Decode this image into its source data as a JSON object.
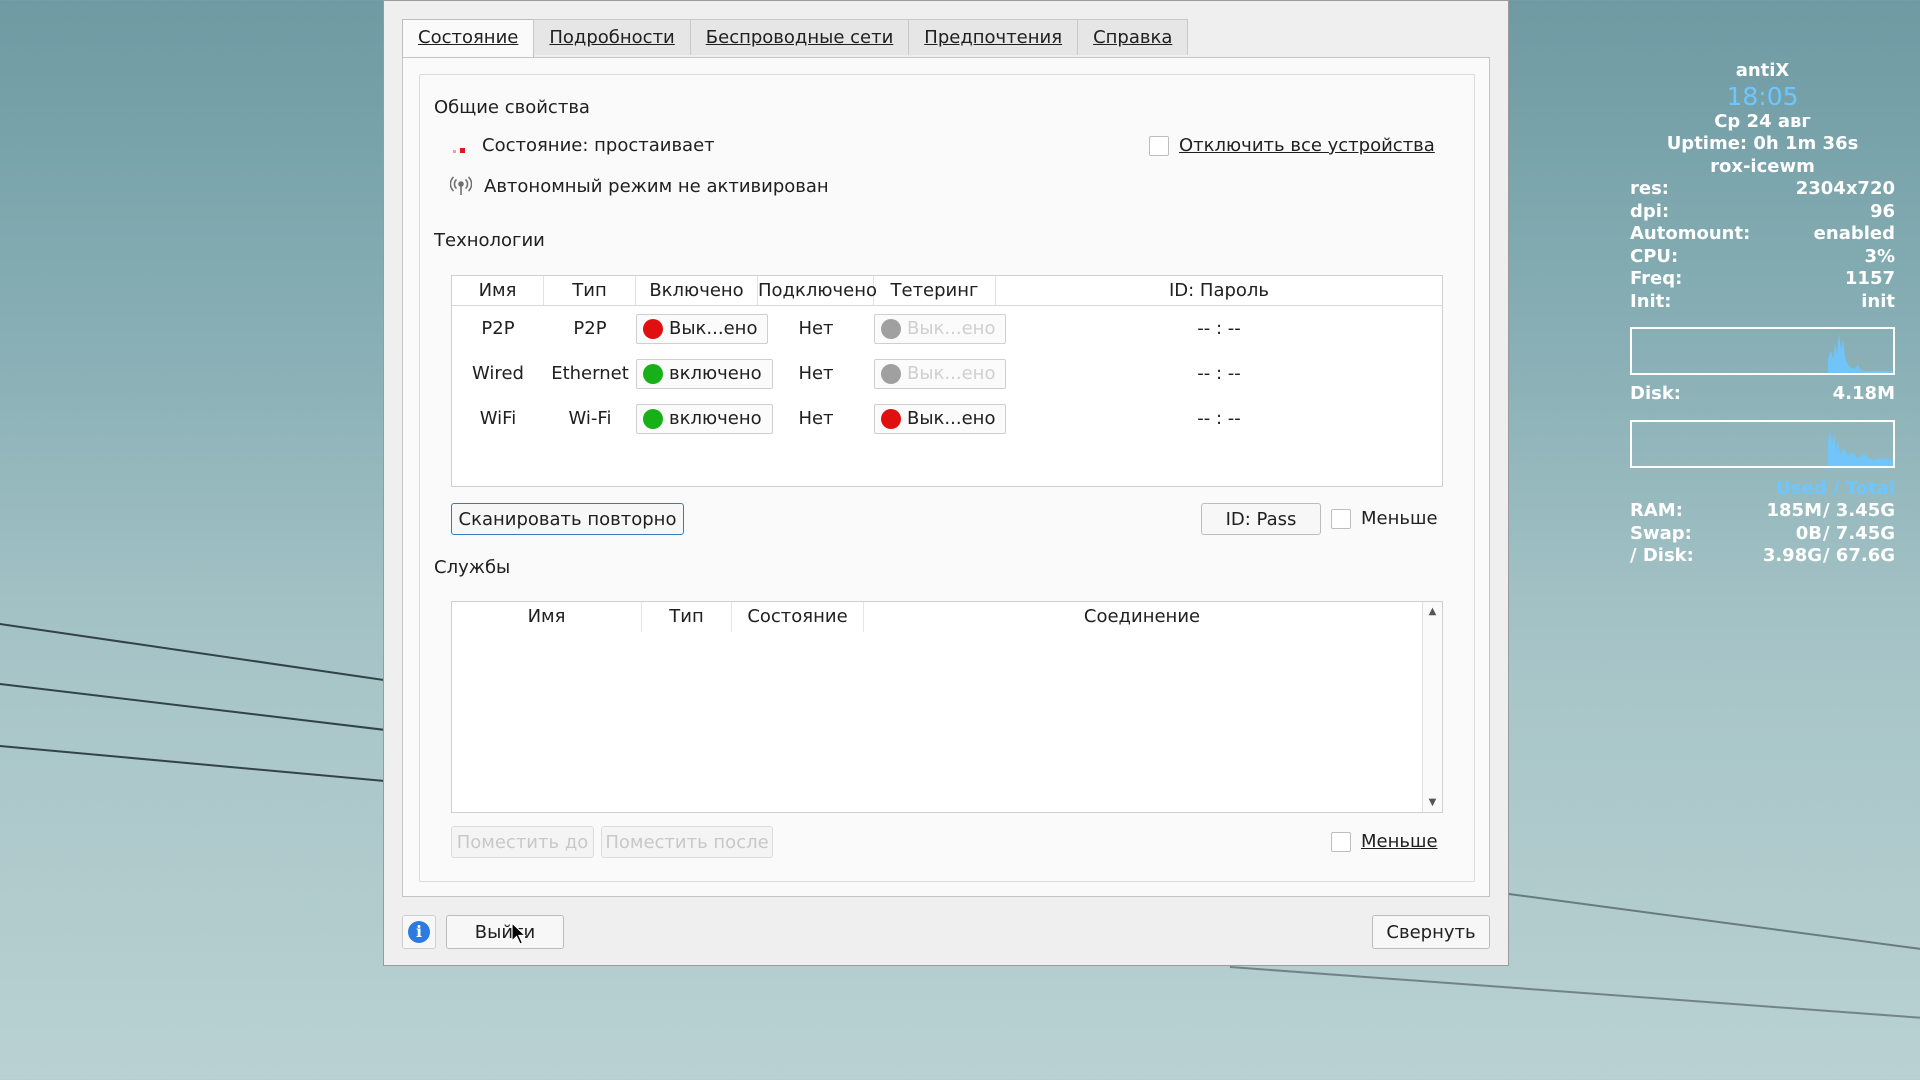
{
  "window": {
    "tabs": [
      {
        "label": "Состояние",
        "active": true
      },
      {
        "label": "Подробности",
        "active": false
      },
      {
        "label": "Беспроводные сети",
        "active": false
      },
      {
        "label": "Предпочтения",
        "active": false
      },
      {
        "label": "Справка",
        "active": false
      }
    ],
    "general": {
      "title": "Общие свойства",
      "state_text": "Состояние: простаивает",
      "offline_text": "Автономный режим не активирован",
      "disable_all_label": "Отключить все устройства",
      "disable_all_checked": false
    },
    "technologies": {
      "title": "Технологии",
      "columns": [
        "Имя",
        "Тип",
        "Включено",
        "Подключено",
        "Тетеринг",
        "ID: Пароль"
      ],
      "rows": [
        {
          "name": "P2P",
          "type": "P2P",
          "enabled": "Вык...ено",
          "enabled_color": "#e01010",
          "connected": "Нет",
          "tethering": "Вык...ено",
          "tethering_color": "#a0a0a0",
          "tethering_disabled": true,
          "idpass": "-- : --"
        },
        {
          "name": "Wired",
          "type": "Ethernet",
          "enabled": "включено",
          "enabled_color": "#18b018",
          "connected": "Нет",
          "tethering": "Вык...ено",
          "tethering_color": "#a0a0a0",
          "tethering_disabled": true,
          "idpass": "-- : --"
        },
        {
          "name": "WiFi",
          "type": "Wi-Fi",
          "enabled": "включено",
          "enabled_color": "#18b018",
          "connected": "Нет",
          "tethering": "Вык...ено",
          "tethering_color": "#e01010",
          "tethering_disabled": false,
          "idpass": "-- : --"
        }
      ],
      "rescan_label": "Сканировать повторно",
      "idpass_button": "ID: Pass",
      "less_label": "Меньше"
    },
    "services": {
      "title": "Службы",
      "columns": [
        "Имя",
        "Тип",
        "Состояние",
        "Соединение"
      ],
      "move_before": "Поместить до",
      "move_after": "Поместить после",
      "less_label": "Меньше"
    },
    "bottom": {
      "exit_label": "Выйти",
      "minimize_label": "Свернуть",
      "info_icon": "info-icon"
    }
  },
  "conky": {
    "host": "antiX",
    "time": "18:05",
    "date": "Ср 24 авг",
    "uptime": "Uptime: 0h 1m 36s",
    "wm": "rox-icewm",
    "stats": [
      {
        "label": "res:",
        "value": "2304x720"
      },
      {
        "label": "dpi:",
        "value": "96"
      },
      {
        "label": "Automount:",
        "value": "enabled"
      },
      {
        "label": "CPU:",
        "value": "3%"
      },
      {
        "label": "Freq:",
        "value": "1157"
      },
      {
        "label": "Init:",
        "value": "init"
      }
    ],
    "disk_label": "Disk:",
    "disk_value": "4.18M",
    "used_total": "Used / Total",
    "mem": [
      {
        "label": "RAM:",
        "used": "185M",
        "total": "/ 3.45G"
      },
      {
        "label": "Swap:",
        "used": "0B",
        "total": "/ 7.45G"
      },
      {
        "label": "/ Disk:",
        "used": "3.98G",
        "total": "/ 67.6G"
      }
    ],
    "accent": "#6ec6ff"
  }
}
